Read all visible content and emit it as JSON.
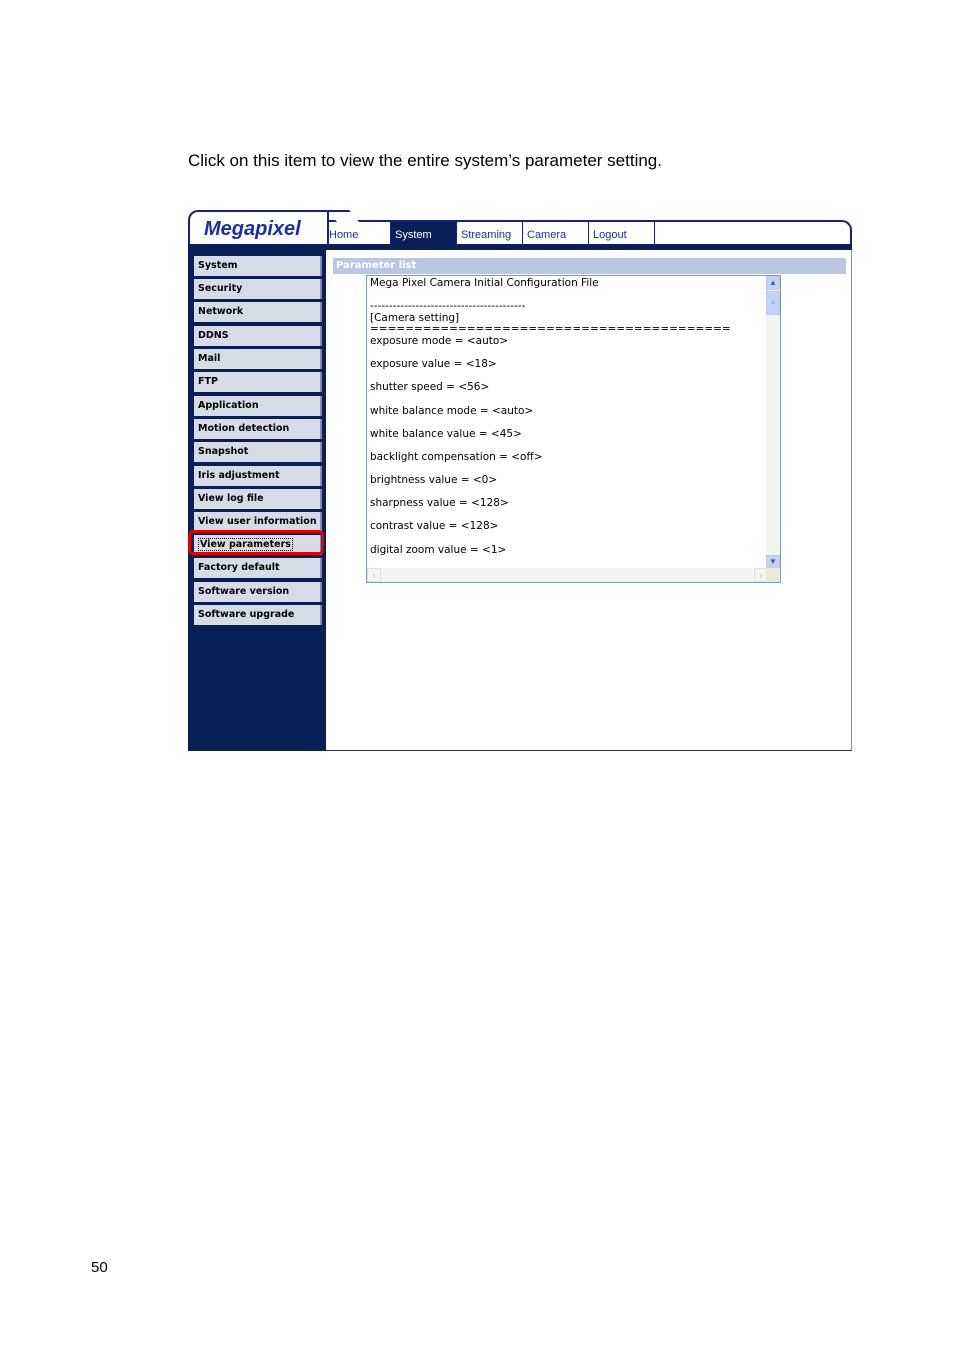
{
  "document": {
    "instruction": "Click on this item to view the entire system’s parameter setting.",
    "page_number": "50"
  },
  "app": {
    "logo": "Megapixel",
    "nav": [
      {
        "label": "Home",
        "active": false
      },
      {
        "label": "System",
        "active": true
      },
      {
        "label": "Streaming",
        "active": false
      },
      {
        "label": "Camera",
        "active": false
      },
      {
        "label": "Logout",
        "active": false
      }
    ],
    "sidebar": [
      {
        "label": "System"
      },
      {
        "label": "Security"
      },
      {
        "label": "Network"
      },
      {
        "label": "DDNS"
      },
      {
        "label": "Mail"
      },
      {
        "label": "FTP"
      },
      {
        "label": "Application"
      },
      {
        "label": "Motion detection"
      },
      {
        "label": "Snapshot"
      },
      {
        "label": "Iris adjustment"
      },
      {
        "label": "View log file"
      },
      {
        "label": "View user information"
      },
      {
        "label": "View parameters",
        "selected": true
      },
      {
        "label": "Factory default"
      },
      {
        "label": "Software version"
      },
      {
        "label": "Software upgrade"
      }
    ],
    "content": {
      "section_title": "Parameter list",
      "parameter_lines": [
        "Mega Pixel Camera Initial Configuration File",
        "",
        "-----------------------------------------",
        "[Camera setting]",
        "=========================================",
        "exposure mode = <auto>",
        "",
        "exposure value = <18>",
        "",
        "shutter speed = <56>",
        "",
        "white balance mode = <auto>",
        "",
        "white balance value = <45>",
        "",
        "backlight compensation = <off>",
        "",
        "brightness value = <0>",
        "",
        "sharpness value = <128>",
        "",
        "contrast value = <128>",
        "",
        "digital zoom value = <1>"
      ]
    },
    "icons": {
      "scroll_up": "▲",
      "scroll_down": "▼",
      "scroll_left": "‹",
      "scroll_right": "›",
      "thumb_grip": "≡"
    },
    "colors": {
      "navy": "#0b1f57",
      "highlight": "#e00000",
      "section_head": "#b8c8e0"
    }
  }
}
